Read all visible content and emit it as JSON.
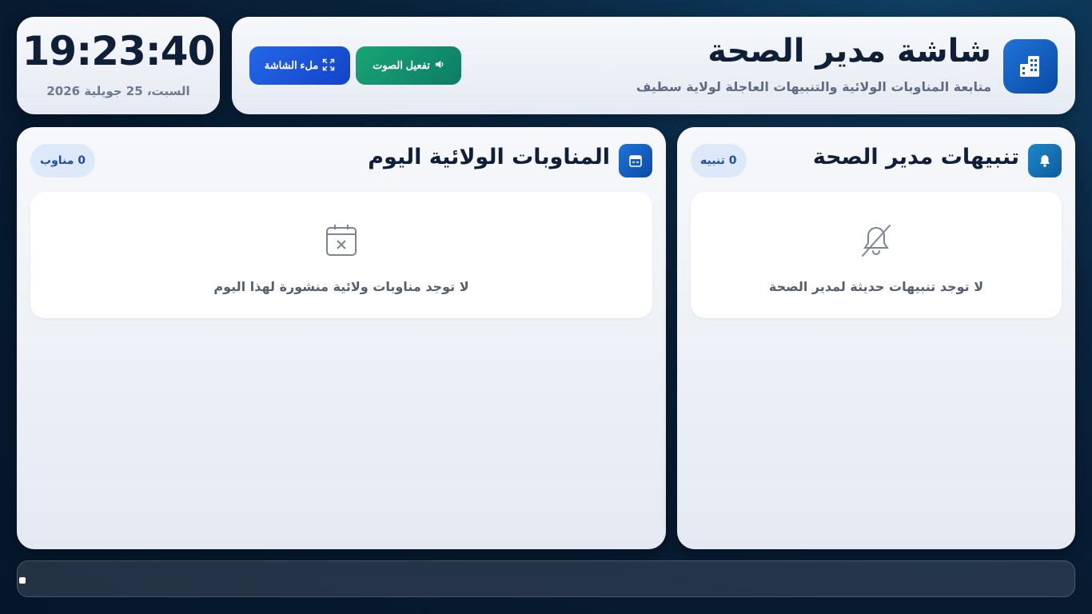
{
  "header": {
    "title": "شاشة مدير الصحة",
    "subtitle": "متابعة المناوبات الولائية والتنبيهات العاجلة لولاية سطيف",
    "icon": "building-icon",
    "sound_button_label": "تفعيل الصوت",
    "fullscreen_button_label": "ملء الشاشة"
  },
  "clock": {
    "time": "19:23:40",
    "date": "السبت، 25 جويلية 2026"
  },
  "duty_panel": {
    "title": "المناوبات الولائية اليوم",
    "badge": "0 مناوب",
    "icon": "calendar-icon",
    "empty_icon": "calendar-x-icon",
    "empty_text": "لا توجد مناوبات ولائية منشورة لهذا اليوم"
  },
  "alerts_panel": {
    "title": "تنبيهات مدير الصحة",
    "badge": "0 تنبيه",
    "icon": "bell-icon",
    "empty_icon": "bell-off-icon",
    "empty_text": "لا توجد تنبيهات حديثة لمدير الصحة"
  },
  "colors": {
    "primary_blue": "#1244c8",
    "success_green": "#0e7c66",
    "dark_text": "#0f1f38",
    "background": "#0a2540"
  }
}
